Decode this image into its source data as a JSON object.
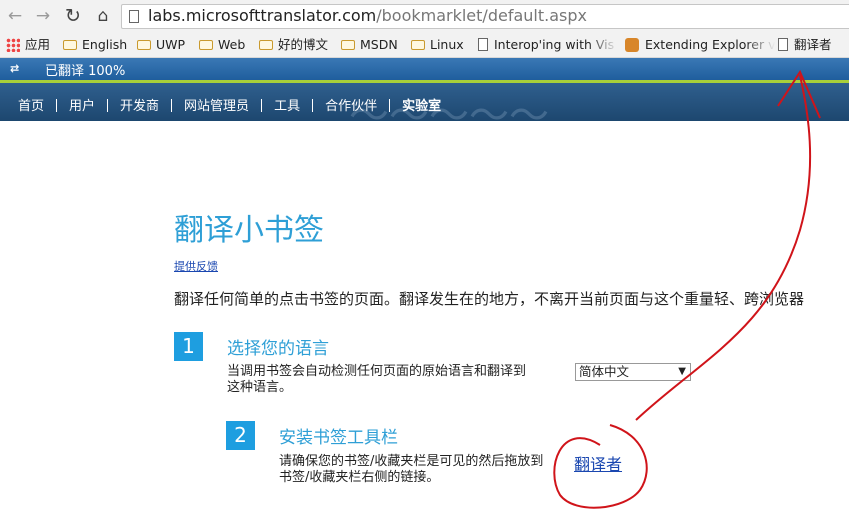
{
  "browser": {
    "url_host": "labs.microsofttranslator.com",
    "url_path": "/bookmarklet/default.aspx",
    "nav_icons": [
      "back-arrow-icon",
      "forward-arrow-icon",
      "reload-icon",
      "home-icon"
    ]
  },
  "bookmarks": [
    {
      "label": "应用",
      "icon": "apps-grid-icon"
    },
    {
      "label": "English",
      "icon": "folder-icon"
    },
    {
      "label": "UWP",
      "icon": "folder-icon"
    },
    {
      "label": "Web",
      "icon": "folder-icon"
    },
    {
      "label": "好的博文",
      "icon": "folder-icon"
    },
    {
      "label": "MSDN",
      "icon": "folder-icon"
    },
    {
      "label": "Linux",
      "icon": "folder-icon"
    },
    {
      "label": "Interop'ing with Vis",
      "icon": "page-icon"
    },
    {
      "label": "Extending Explorer v",
      "icon": "extension-icon"
    },
    {
      "label": "翻译者",
      "icon": "page-icon"
    }
  ],
  "translator_bar": {
    "status": "已翻译 100%"
  },
  "site_nav": {
    "items": [
      "首页",
      "用户",
      "开发商",
      "网站管理员",
      "工具",
      "合作伙伴",
      "实验室"
    ],
    "active": "实验室"
  },
  "main": {
    "title": "翻译小书签",
    "feedback_link": "提供反馈",
    "intro": "翻译任何简单的点击书签的页面。翻译发生在的地方，不离开当前页面与这个重量轻、跨浏览器",
    "steps": [
      {
        "number": "1",
        "title": "选择您的语言",
        "description": "当调用书签会自动检测任何页面的原始语言和翻译到这种语言。"
      },
      {
        "number": "2",
        "title": "安装书签工具栏",
        "description": "请确保您的书签/收藏夹栏是可见的然后拖放到书签/收藏夹栏右侧的链接。"
      }
    ],
    "language_select": {
      "selected": "简体中文"
    },
    "bookmarklet_link": "翻译者"
  },
  "colors": {
    "accent": "#2e9fd6",
    "step_badge": "#1e9ee0",
    "annotation": "#d0141a",
    "translator_bar": "#1f5e9d",
    "translator_bar_accent": "#a8cf3a"
  }
}
